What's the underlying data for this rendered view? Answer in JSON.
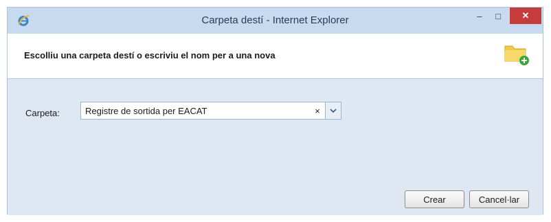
{
  "window": {
    "title": "Carpeta destí - Internet Explorer",
    "minimize_glyph": "–",
    "maximize_glyph": "□",
    "close_glyph": "✕"
  },
  "header": {
    "instruction": "Escolliu una carpeta destí o escriviu el nom per a una nova",
    "icon": "folder-add-icon"
  },
  "form": {
    "folder_label": "Carpeta:",
    "folder_value": "Registre de sortida per EACAT",
    "clear_glyph": "×",
    "dropdown_icon": "chevron-down-icon"
  },
  "buttons": {
    "create_label": "Crear",
    "cancel_label": "Cancel·lar"
  },
  "colors": {
    "frame": "#c7daef",
    "close_button": "#c63b3b",
    "folder": "#f2c94c",
    "add_badge": "#3aa63a"
  }
}
